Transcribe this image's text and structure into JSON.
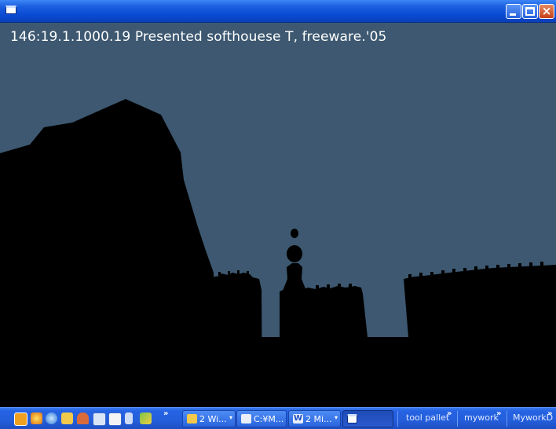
{
  "window": {
    "title": "",
    "controls": {
      "minimize": "minimize",
      "maximize": "maximize",
      "close": "×"
    }
  },
  "scene": {
    "overlay_text": "146:19.1.1000.19 Presented softhouese T, freeware.'05",
    "sky_color": "#3d5870",
    "silhouette_color": "#000000"
  },
  "taskbar": {
    "quicklaunch": [
      {
        "name": "media-player-icon",
        "color": "#f0a020"
      },
      {
        "name": "browser-icon",
        "color": "#e8e040"
      },
      {
        "name": "internet-explorer-icon",
        "color": "#6fb0ff"
      },
      {
        "name": "folder-icon",
        "color": "#f3c94b"
      },
      {
        "name": "app-icon",
        "color": "#d96b3a"
      },
      {
        "name": "document-icon",
        "color": "#d9e4f7"
      },
      {
        "name": "notepad-icon",
        "color": "#f4f4f4"
      },
      {
        "name": "text-file-icon",
        "color": "#cfdcf5"
      },
      {
        "name": "tool-icon",
        "color": "#7cc34a"
      }
    ],
    "chevron": "»",
    "buttons": [
      {
        "label": "2 Wi...",
        "icon": "folder-icon",
        "dropdown": "▾",
        "active": false
      },
      {
        "label": "C:¥M...",
        "icon": "document-icon",
        "dropdown": "",
        "active": false
      },
      {
        "label": "2 Mi...",
        "icon": "word-icon",
        "dropdown": "▾",
        "active": false
      },
      {
        "label": "",
        "icon": "window-icon",
        "dropdown": "",
        "active": true
      }
    ],
    "toolbars": [
      {
        "label": "tool pallet"
      },
      {
        "label": "mywork"
      },
      {
        "label": "MyworkD"
      }
    ]
  }
}
